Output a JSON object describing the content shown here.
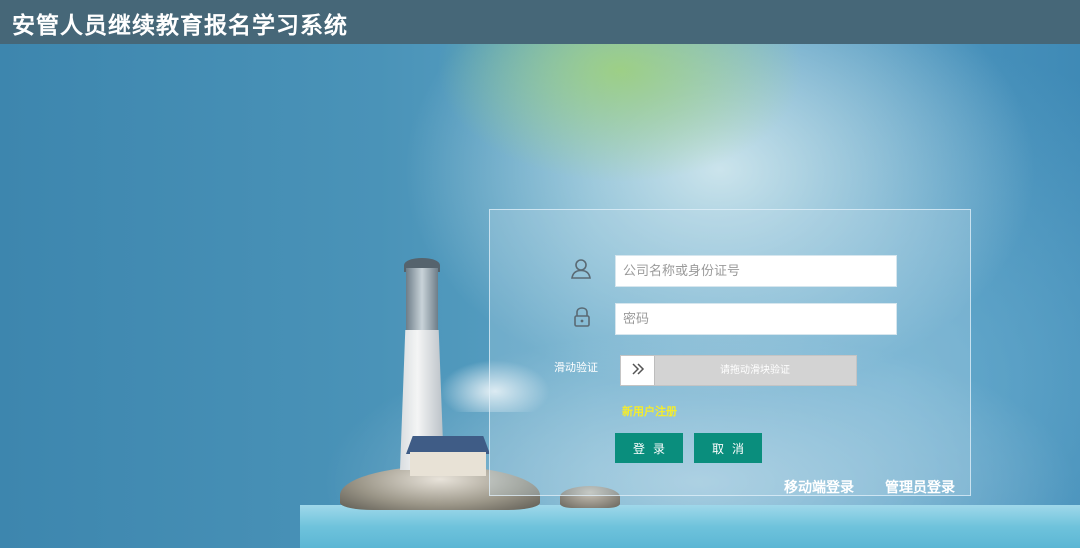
{
  "header": {
    "title": "安管人员继续教育报名学习系统"
  },
  "login": {
    "username_placeholder": "公司名称或身份证号",
    "username_value": "",
    "password_placeholder": "密码",
    "password_value": "",
    "slider_label": "滑动验证",
    "slider_text": "请拖动滑块验证",
    "register_link": "新用户注册",
    "login_button": "登录",
    "cancel_button": "取消",
    "mobile_login": "移动端登录",
    "admin_login": "管理员登录"
  },
  "icons": {
    "user": "user-icon",
    "lock": "lock-icon",
    "slider": "double-chevron-right-icon"
  },
  "colors": {
    "topbar": "#466778",
    "button": "#0a8e7d",
    "register_link": "#f4ec2c"
  }
}
